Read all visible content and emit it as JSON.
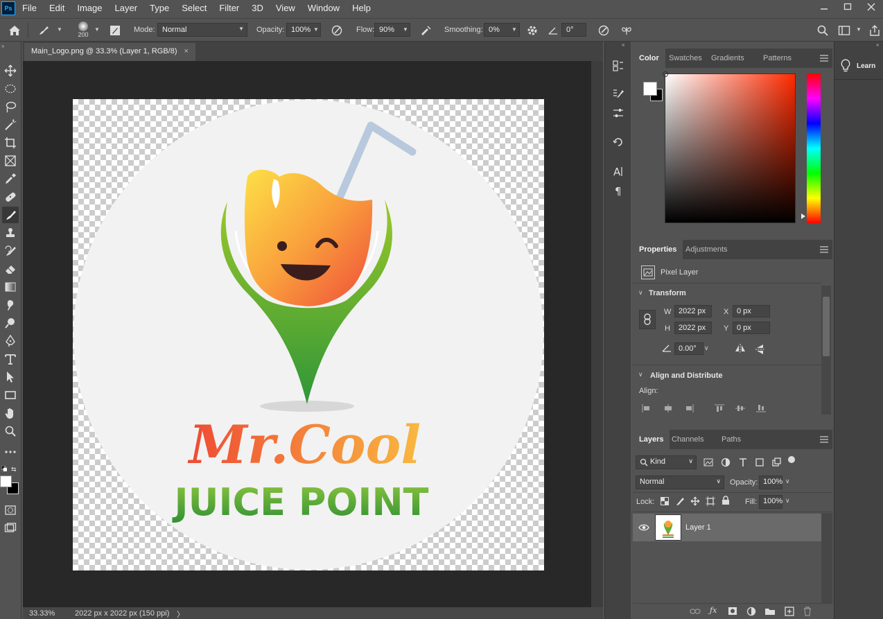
{
  "app": {
    "logo_text": "Ps"
  },
  "menu": [
    "File",
    "Edit",
    "Image",
    "Layer",
    "Type",
    "Select",
    "Filter",
    "3D",
    "View",
    "Window",
    "Help"
  ],
  "options_bar": {
    "brush_size": "200",
    "mode_label": "Mode:",
    "mode_value": "Normal",
    "opacity_label": "Opacity:",
    "opacity_value": "100%",
    "flow_label": "Flow:",
    "flow_value": "90%",
    "smoothing_label": "Smoothing:",
    "smoothing_value": "0%",
    "angle_value": "0°"
  },
  "document": {
    "tab_title": "Main_Logo.png @ 33.3% (Layer 1, RGB/8)",
    "close_glyph": "×",
    "logo_line1": "Mr.Cool",
    "logo_line2": "JUICE POINT"
  },
  "status": {
    "zoom": "33.33%",
    "doc_info": "2022 px x 2022 px (150 ppi)",
    "arrow": "〉"
  },
  "color_panel": {
    "tabs": [
      "Color",
      "Swatches",
      "Gradients",
      "Patterns"
    ],
    "foreground": "#ffffff",
    "background": "#000000",
    "hue_color": "#ff2a00"
  },
  "properties_panel": {
    "tabs": [
      "Properties",
      "Adjustments"
    ],
    "layer_type": "Pixel Layer",
    "transform_title": "Transform",
    "w_label": "W",
    "w_value": "2022 px",
    "h_label": "H",
    "h_value": "2022 px",
    "x_label": "X",
    "x_value": "0 px",
    "y_label": "Y",
    "y_value": "0 px",
    "angle_value": "0.00°",
    "align_title": "Align and Distribute",
    "align_label": "Align:"
  },
  "layers_panel": {
    "tabs": [
      "Layers",
      "Channels",
      "Paths"
    ],
    "filter_kind": "Kind",
    "blend_mode": "Normal",
    "opacity_label": "Opacity:",
    "opacity_value": "100%",
    "lock_label": "Lock:",
    "fill_label": "Fill:",
    "fill_value": "100%",
    "layer_name": "Layer 1"
  },
  "learn": {
    "label": "Learn"
  }
}
